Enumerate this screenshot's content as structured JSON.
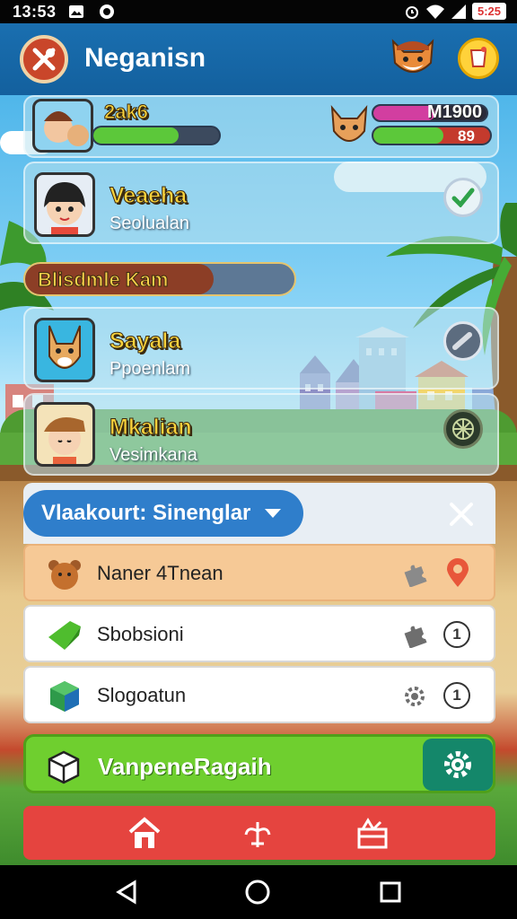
{
  "status_bar": {
    "time": "13:53",
    "battery": "5:25",
    "icons": [
      "image-icon",
      "sync-icon",
      "alarm-icon",
      "wifi-icon",
      "signal-icon",
      "battery-icon"
    ]
  },
  "app_bar": {
    "title": "Neganisn",
    "icons": [
      "menu-tools-icon",
      "fox-avatar-icon",
      "cup-icon"
    ]
  },
  "players": [
    {
      "name": "2ak6",
      "progress": 0.68,
      "avatar": "girl-cat-avatar"
    },
    {
      "name": "Veaeha",
      "subtitle": "Seolualan",
      "avatar": "girl-dark-hair-avatar",
      "badge": "check-icon"
    },
    {
      "name": "Sayala",
      "subtitle": "Ppoenlam",
      "avatar": "kangaroo-avatar",
      "badge": "telescope-icon"
    },
    {
      "name": "Mkalian",
      "subtitle": "Vesimkana",
      "avatar": "boy-brown-hair-avatar",
      "badge": "compass-icon"
    }
  ],
  "opponent": {
    "score": "M1900",
    "sub_score": "89",
    "energy": 0.55,
    "health": 0.6,
    "avatar": "fox-avatar"
  },
  "banner_bar": {
    "label": "Blisdmle Kam",
    "progress": 0.7
  },
  "dropdown": {
    "selected": "Vlaakourt: Sinenglar",
    "close_icon": "close-icon"
  },
  "list_items": [
    {
      "label": "Naner 4Tnean",
      "icon": "bear-icon",
      "mid_icon": "puzzle-icon",
      "right": "pin-icon",
      "highlighted": true
    },
    {
      "label": "Sbobsioni",
      "icon": "green-arrow-icon",
      "mid_icon": "puzzle-icon",
      "right": "1"
    },
    {
      "label": "Slogoatun",
      "icon": "green-cube-icon",
      "mid_icon": "gear-icon",
      "right": "1"
    }
  ],
  "action_button": {
    "label": "VanpeneRagaih",
    "icon": "cube-icon",
    "right_icon": "gear-icon"
  },
  "bottom_bar": {
    "icons": [
      "home-icon",
      "sprout-icon",
      "gift-icon"
    ]
  },
  "colors": {
    "app_bar": "#1a6fb0",
    "action_green": "#6fcf2f",
    "bottom_red": "#e5443f",
    "dropdown_blue": "#2f7ecb",
    "highlight_row": "#f6c996"
  }
}
